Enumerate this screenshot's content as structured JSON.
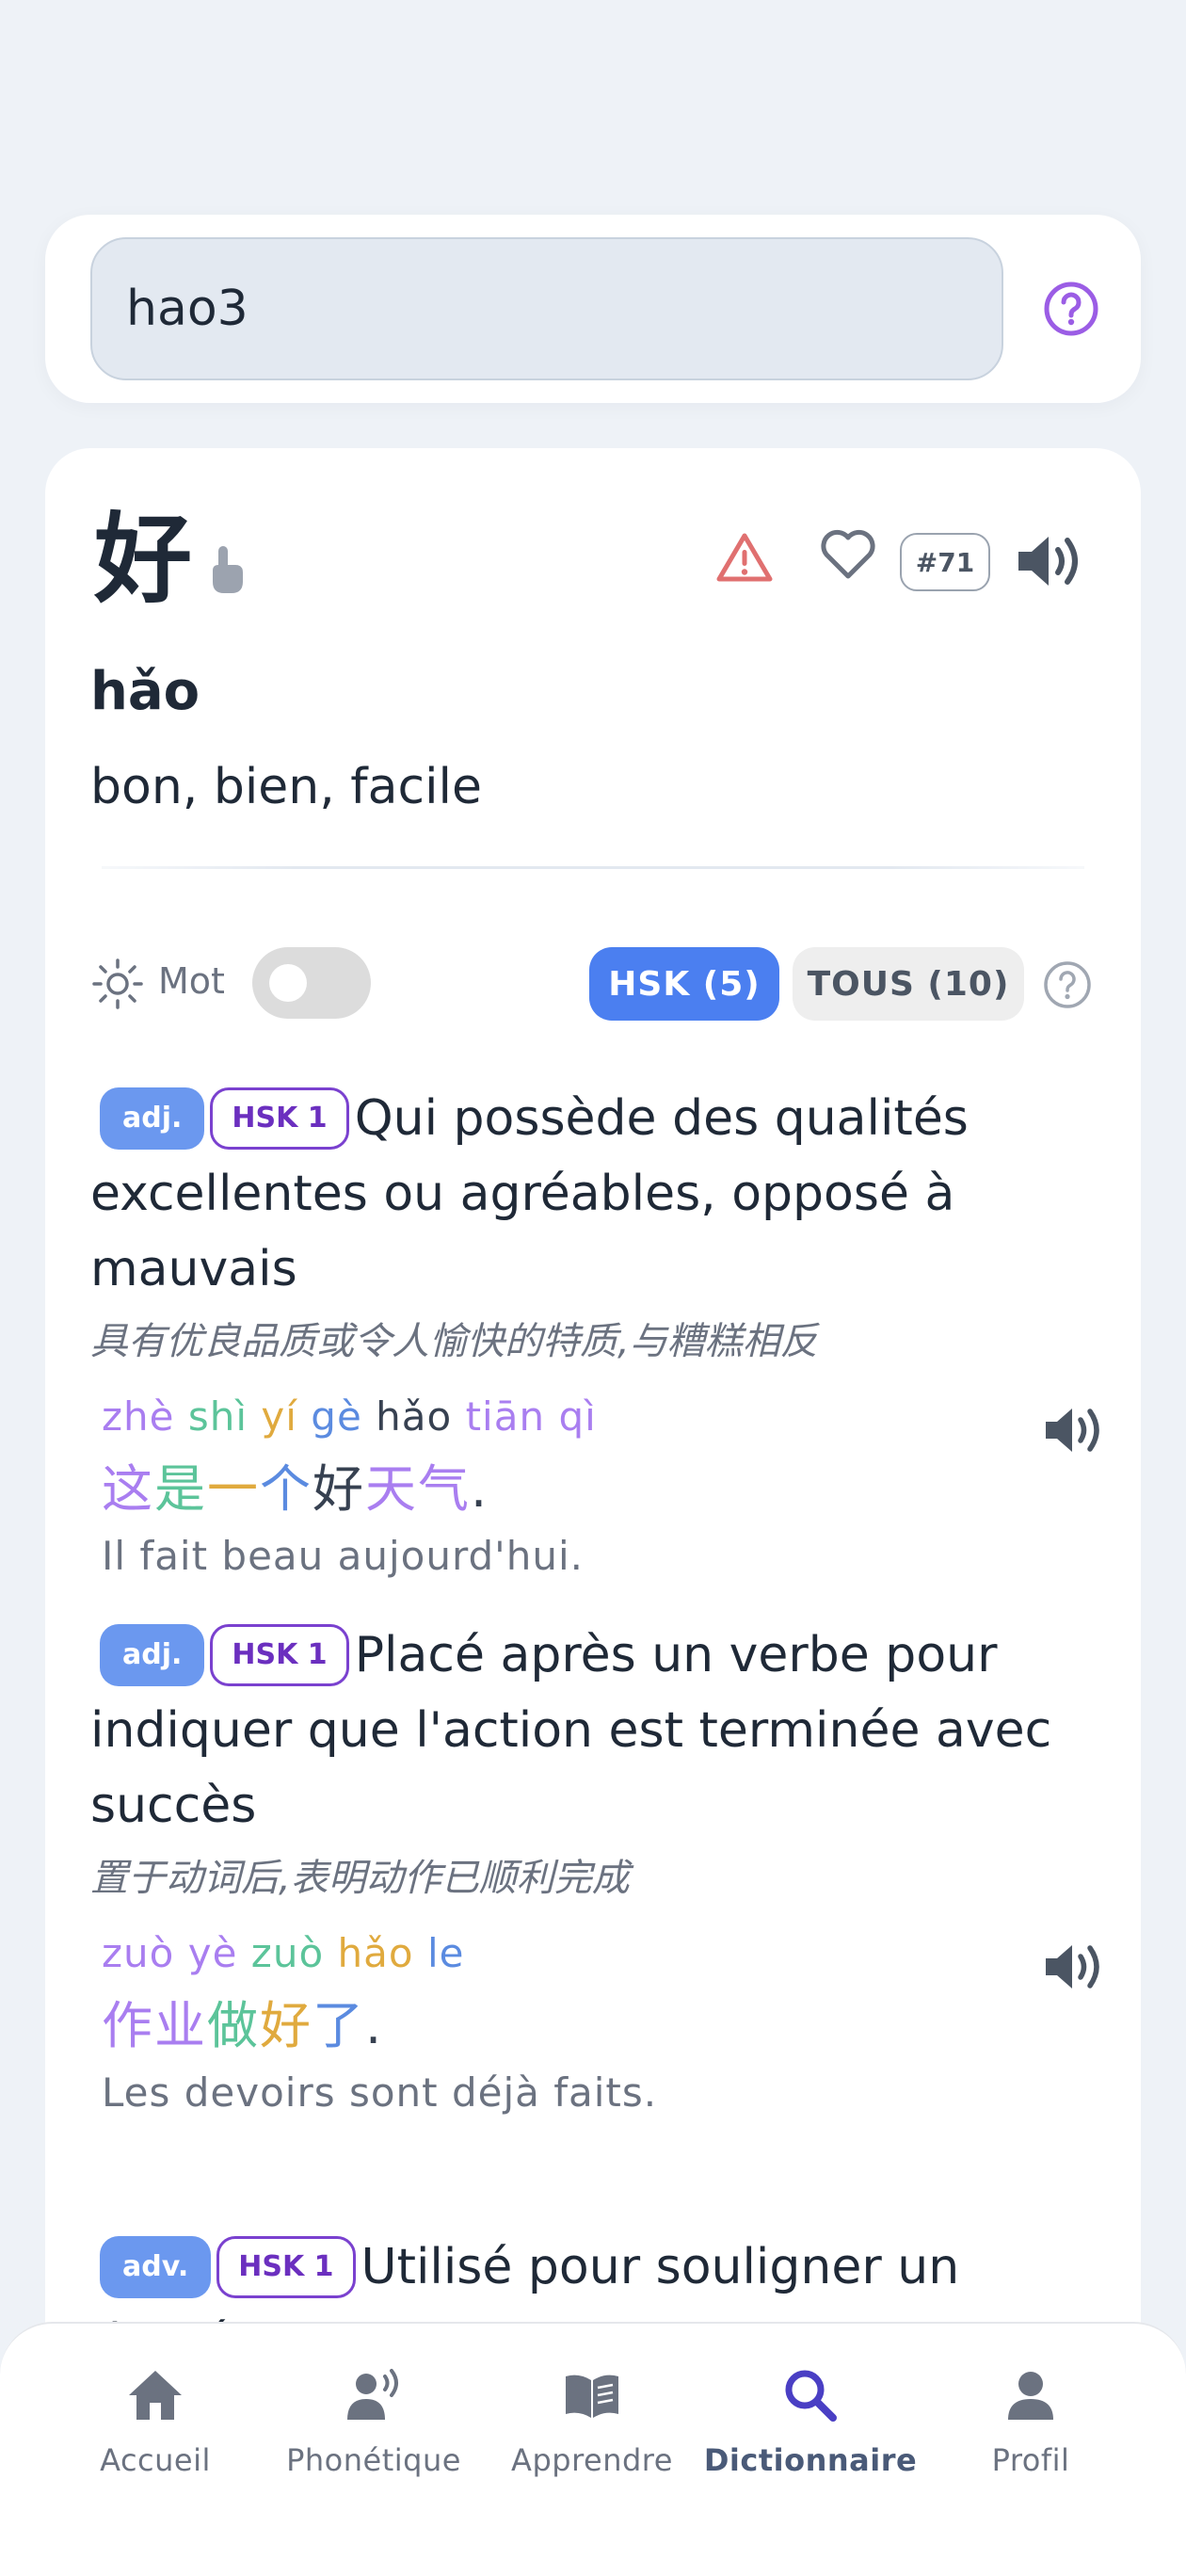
{
  "search": {
    "value": "hao3",
    "help_icon": "question-circle-icon"
  },
  "word": {
    "hanzi": "好",
    "rank": "#71",
    "pinyin": "hǎo",
    "meaning": "bon, bien, facile"
  },
  "filters": {
    "mot_label": "Mot",
    "hsk_label": "HSK (5)",
    "all_label": "TOUS (10)"
  },
  "definitions": [
    {
      "pos": "adj.",
      "hsk": "HSK 1",
      "text": "Qui possède des qualités excellentes ou agréables, opposé à mauvais",
      "zh": "具有优良品质或令人愉快的特质,与糟糕相反",
      "example": {
        "pinyin": [
          "zhè",
          "shì",
          "yí",
          "gè",
          "hǎo",
          "tiān",
          "qì"
        ],
        "hanzi": [
          "这",
          "是",
          "一",
          "个",
          "好",
          "天气",
          "."
        ],
        "translation": "Il fait beau aujourd'hui."
      }
    },
    {
      "pos": "adj.",
      "hsk": "HSK 1",
      "text": "Placé après un verbe pour indiquer que l'action est terminée avec succès",
      "zh": "置于动词后,表明动作已顺利完成",
      "example": {
        "pinyin": [
          "zuò",
          "yè",
          "zuò",
          "hǎo",
          "le"
        ],
        "hanzi": [
          "作业",
          "做",
          "好",
          "了",
          "."
        ],
        "translation": "Les devoirs sont déjà faits."
      }
    },
    {
      "pos": "adv.",
      "hsk": "HSK 1",
      "text": "Utilisé pour souligner un degré"
    }
  ],
  "nav": [
    {
      "label": "Accueil",
      "icon": "home-icon"
    },
    {
      "label": "Phonétique",
      "icon": "speaking-person-icon"
    },
    {
      "label": "Apprendre",
      "icon": "book-icon"
    },
    {
      "label": "Dictionnaire",
      "icon": "search-icon"
    },
    {
      "label": "Profil",
      "icon": "user-icon"
    }
  ],
  "colors": {
    "accent_blue": "#4b7ff0",
    "hsk_purple": "#7a41cf",
    "warning": "#e07070"
  }
}
